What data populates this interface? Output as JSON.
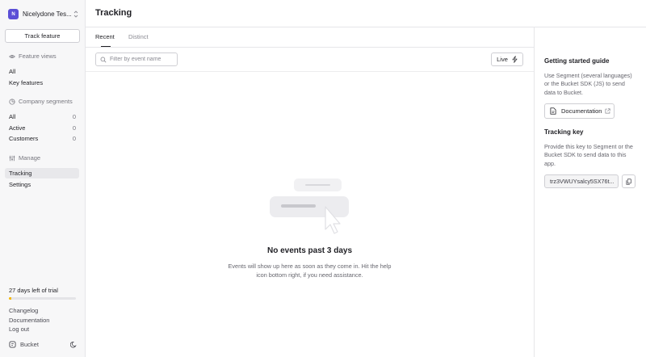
{
  "sidebar": {
    "org": {
      "initial": "N",
      "name": "Nicelydone Tes..."
    },
    "track_feature_label": "Track feature",
    "feature_views": {
      "heading": "Feature views",
      "items": [
        {
          "label": "All"
        },
        {
          "label": "Key features"
        }
      ]
    },
    "company_segments": {
      "heading": "Company segments",
      "items": [
        {
          "label": "All",
          "count": "0"
        },
        {
          "label": "Active",
          "count": "0"
        },
        {
          "label": "Customers",
          "count": "0"
        }
      ]
    },
    "manage": {
      "heading": "Manage",
      "items": [
        {
          "label": "Tracking",
          "active": true
        },
        {
          "label": "Settings"
        }
      ]
    },
    "trial": {
      "label": "27 days left of trial",
      "progress_fraction": 0.04,
      "color": "#f5b700"
    },
    "links": [
      "Changelog",
      "Documentation",
      "Log out"
    ],
    "brand": "Bucket"
  },
  "main": {
    "title": "Tracking",
    "tabs": [
      {
        "label": "Recent",
        "active": true
      },
      {
        "label": "Distinct",
        "active": false
      }
    ],
    "search": {
      "placeholder": "Filter by event name",
      "value": ""
    },
    "live_label": "Live",
    "empty_state": {
      "title": "No events past 3 days",
      "description": "Events will show up here as soon as they come in. Hit the help icon bottom right, if you need assistance."
    }
  },
  "right_panel": {
    "guide": {
      "heading": "Getting started guide",
      "text": "Use Segment (several languages) or the Bucket SDK (JS) to send data to Bucket.",
      "doc_button": "Documentation"
    },
    "tracking_key": {
      "heading": "Tracking key",
      "text": "Provide this key to Segment or the Bucket SDK to send data to this app.",
      "value": "trz3VWUYsalcy5SX76t..."
    }
  },
  "colors": {
    "accent": "#5b4fd6",
    "trial_bar": "#f5b700"
  },
  "icons": [
    "chevron-updown-icon",
    "eye-icon",
    "circle-segment-icon",
    "sliders-icon",
    "search-icon",
    "lightning-icon",
    "document-icon",
    "external-link-icon",
    "copy-icon",
    "bucket-logo-icon",
    "moon-icon",
    "cursor-icon"
  ]
}
